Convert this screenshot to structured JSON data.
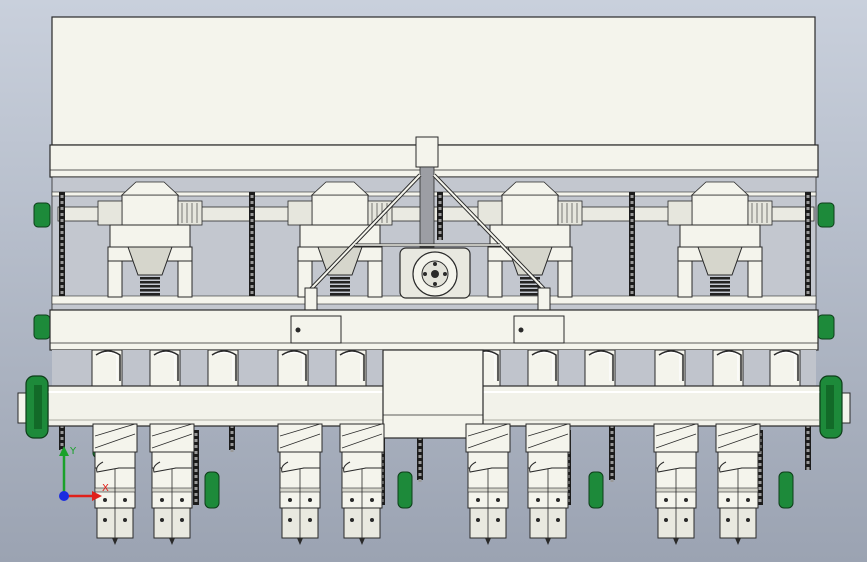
{
  "viewport": {
    "background_top": "#c9d0dc",
    "background_bottom": "#9ba3b2"
  },
  "model": {
    "part_fill": "#f4f4ec",
    "part_stroke": "#2a2a2a",
    "shadow_fill": "#d6d6cc",
    "chain_color": "#1c1c1c",
    "sprocket_color": "#1d8a3a",
    "metering_units": 4,
    "furrow_openers": 8
  },
  "triad": {
    "x_label": "X",
    "y_label": "Y",
    "x_color": "#e0201a",
    "y_color": "#1aa12a",
    "z_color": "#1a2ce0"
  }
}
